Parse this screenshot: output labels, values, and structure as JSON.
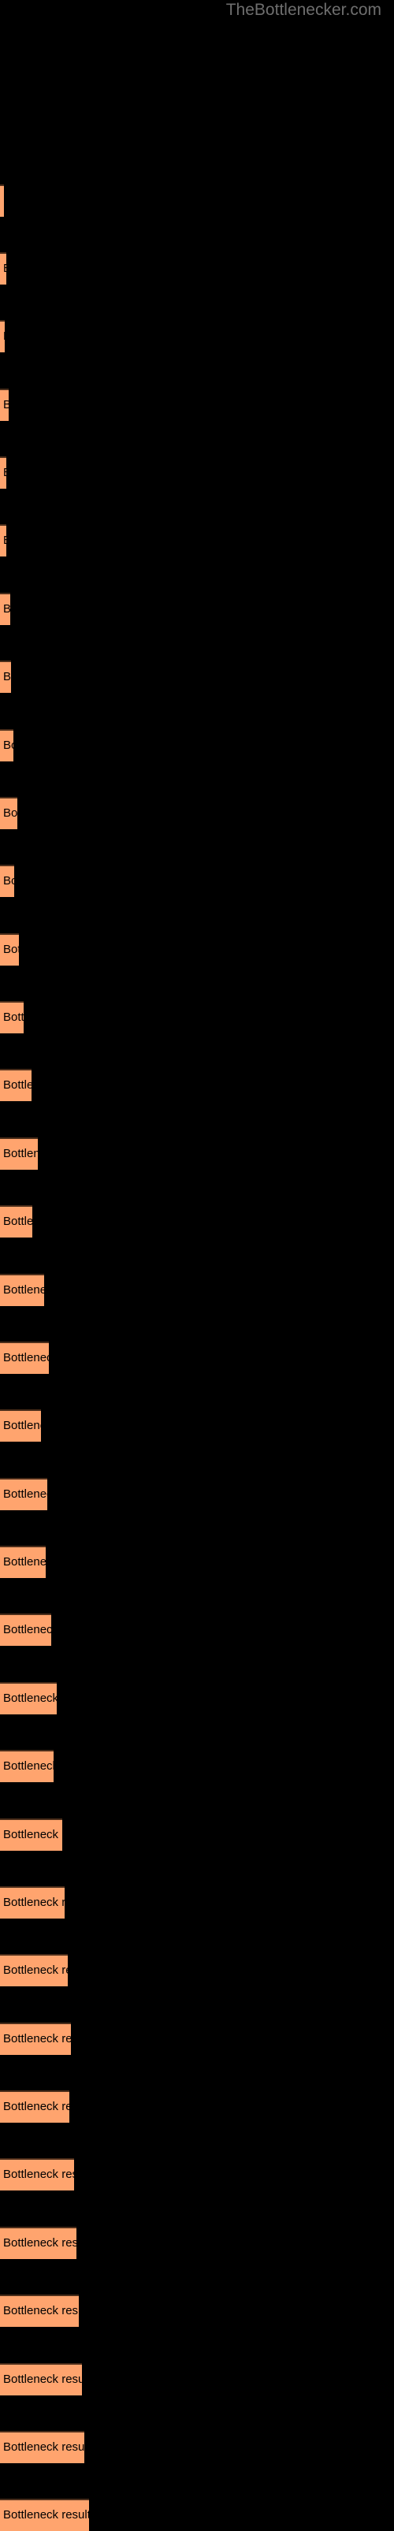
{
  "watermark": {
    "text": "TheBottlenecker.com",
    "color": "#6e6e6e"
  },
  "colors": {
    "background": "#000000",
    "bar_fill": "#ffa46e",
    "bar_top_edge": "#4a2d1a",
    "label_text": "#000000"
  },
  "chart_data": {
    "type": "bar",
    "orientation": "horizontal",
    "title": "",
    "subtitle": "",
    "xlabel": "",
    "ylabel": "",
    "grid": false,
    "legend": null,
    "bar_label_text": "Bottleneck result",
    "xlim": [
      0,
      500
    ],
    "categories": [
      "Bottleneck result",
      "Bottleneck result",
      "Bottleneck result",
      "Bottleneck result",
      "Bottleneck result",
      "Bottleneck result",
      "Bottleneck result",
      "Bottleneck result",
      "Bottleneck result",
      "Bottleneck result",
      "Bottleneck result",
      "Bottleneck result",
      "Bottleneck result",
      "Bottleneck result",
      "Bottleneck result",
      "Bottleneck result",
      "Bottleneck result",
      "Bottleneck result",
      "Bottleneck result",
      "Bottleneck result",
      "Bottleneck result",
      "Bottleneck result",
      "Bottleneck result",
      "Bottleneck result",
      "Bottleneck result",
      "Bottleneck result",
      "Bottleneck result",
      "Bottleneck result",
      "Bottleneck result",
      "Bottleneck result",
      "Bottleneck result",
      "Bottleneck result",
      "Bottleneck result",
      "Bottleneck result",
      "Bottleneck result"
    ],
    "values": [
      5,
      8,
      6,
      11,
      8,
      8,
      13,
      14,
      17,
      22,
      18,
      24,
      30,
      40,
      48,
      41,
      56,
      62,
      52,
      60,
      58,
      65,
      72,
      68,
      79,
      82,
      86,
      90,
      88,
      94,
      97,
      100,
      104,
      107,
      113
    ],
    "bars": [
      {
        "index": 1,
        "top": 234,
        "height": 41,
        "width": 5,
        "label": "Bottleneck result"
      },
      {
        "index": 2,
        "top": 320,
        "height": 41,
        "width": 8,
        "label": "Bottleneck result"
      },
      {
        "index": 3,
        "top": 406,
        "height": 41,
        "width": 6,
        "label": "Bottleneck result"
      },
      {
        "index": 4,
        "top": 493,
        "height": 41,
        "width": 11,
        "label": "Bottleneck result"
      },
      {
        "index": 5,
        "top": 579,
        "height": 41,
        "width": 8,
        "label": "Bottleneck result"
      },
      {
        "index": 6,
        "top": 665,
        "height": 41,
        "width": 8,
        "label": "Bottleneck result"
      },
      {
        "index": 7,
        "top": 752,
        "height": 41,
        "width": 13,
        "label": "Bottleneck result"
      },
      {
        "index": 8,
        "top": 838,
        "height": 41,
        "width": 14,
        "label": "Bottleneck result"
      },
      {
        "index": 9,
        "top": 925,
        "height": 41,
        "width": 17,
        "label": "Bottleneck result"
      },
      {
        "index": 10,
        "top": 1011,
        "height": 41,
        "width": 22,
        "label": "Bottleneck result"
      },
      {
        "index": 11,
        "top": 1097,
        "height": 41,
        "width": 18,
        "label": "Bottleneck result"
      },
      {
        "index": 12,
        "top": 1184,
        "height": 41,
        "width": 24,
        "label": "Bottleneck result"
      },
      {
        "index": 13,
        "top": 1270,
        "height": 41,
        "width": 30,
        "label": "Bottleneck result"
      },
      {
        "index": 14,
        "top": 1356,
        "height": 41,
        "width": 40,
        "label": "Bottleneck result"
      },
      {
        "index": 15,
        "top": 1443,
        "height": 41,
        "width": 48,
        "label": "Bottleneck result"
      },
      {
        "index": 16,
        "top": 1529,
        "height": 41,
        "width": 41,
        "label": "Bottleneck result"
      },
      {
        "index": 17,
        "top": 1616,
        "height": 41,
        "width": 56,
        "label": "Bottleneck result"
      },
      {
        "index": 18,
        "top": 1702,
        "height": 41,
        "width": 62,
        "label": "Bottleneck result"
      },
      {
        "index": 19,
        "top": 1788,
        "height": 41,
        "width": 52,
        "label": "Bottleneck result"
      },
      {
        "index": 20,
        "top": 1875,
        "height": 41,
        "width": 60,
        "label": "Bottleneck result"
      },
      {
        "index": 21,
        "top": 1961,
        "height": 41,
        "width": 58,
        "label": "Bottleneck result"
      },
      {
        "index": 22,
        "top": 2047,
        "height": 41,
        "width": 65,
        "label": "Bottleneck result"
      },
      {
        "index": 23,
        "top": 2134,
        "height": 41,
        "width": 72,
        "label": "Bottleneck result"
      },
      {
        "index": 24,
        "top": 2220,
        "height": 41,
        "width": 68,
        "label": "Bottleneck result"
      },
      {
        "index": 25,
        "top": 2307,
        "height": 41,
        "width": 79,
        "label": "Bottleneck result"
      },
      {
        "index": 26,
        "top": 2393,
        "height": 41,
        "width": 82,
        "label": "Bottleneck result"
      },
      {
        "index": 27,
        "top": 2479,
        "height": 41,
        "width": 86,
        "label": "Bottleneck result"
      },
      {
        "index": 28,
        "top": 2566,
        "height": 41,
        "width": 90,
        "label": "Bottleneck result"
      },
      {
        "index": 29,
        "top": 2652,
        "height": 41,
        "width": 88,
        "label": "Bottleneck result"
      },
      {
        "index": 30,
        "top": 2738,
        "height": 41,
        "width": 94,
        "label": "Bottleneck result"
      },
      {
        "index": 31,
        "top": 2825,
        "height": 41,
        "width": 97,
        "label": "Bottleneck result"
      },
      {
        "index": 32,
        "top": 2911,
        "height": 41,
        "width": 100,
        "label": "Bottleneck result"
      },
      {
        "index": 33,
        "top": 2998,
        "height": 41,
        "width": 104,
        "label": "Bottleneck result"
      },
      {
        "index": 34,
        "top": 3084,
        "height": 41,
        "width": 107,
        "label": "Bottleneck result"
      },
      {
        "index": 35,
        "top": 3170,
        "height": 41,
        "width": 113,
        "label": "Bottleneck result"
      }
    ]
  }
}
